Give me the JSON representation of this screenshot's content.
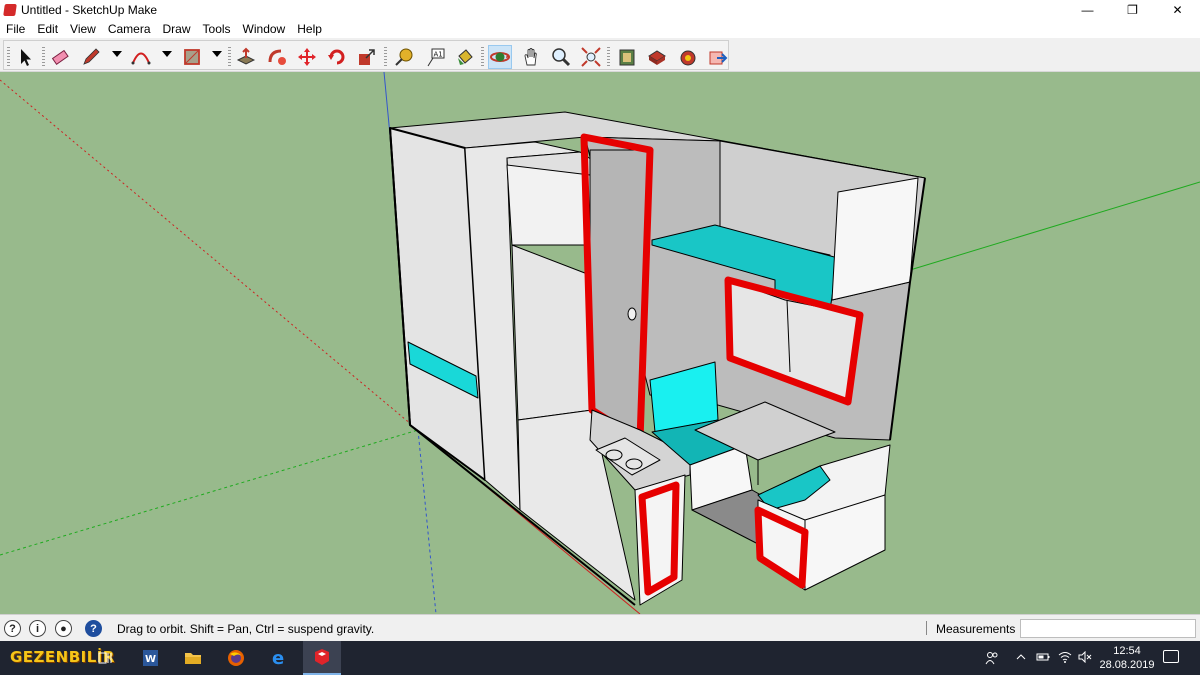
{
  "window": {
    "title": "Untitled - SketchUp Make",
    "minimize": "—",
    "restore": "❐",
    "close": "✕"
  },
  "menu": [
    "File",
    "Edit",
    "View",
    "Camera",
    "Draw",
    "Tools",
    "Window",
    "Help"
  ],
  "toolbar": {
    "tools": [
      "select-icon",
      "eraser-icon",
      "pencil-icon",
      "arc-icon",
      "rectangle-icon",
      "push-pull-icon",
      "follow-me-icon",
      "move-icon",
      "rotate-icon",
      "scale-icon",
      "tape-measure-icon",
      "text-icon",
      "paint-bucket-icon",
      "orbit-icon",
      "pan-icon",
      "zoom-icon",
      "zoom-extents-icon",
      "warehouse-icon",
      "extension-icon",
      "component-icon",
      "share-icon"
    ],
    "active_tool": "orbit-icon"
  },
  "status": {
    "hint": "Drag to orbit. Shift = Pan, Ctrl = suspend gravity.",
    "measurements_label": "Measurements",
    "measurements_value": ""
  },
  "taskbar": {
    "brand": "GEZENBILİR",
    "time": "12:54",
    "date": "28.08.2019"
  },
  "colors": {
    "sky": "#98ba8c",
    "accent_red": "#e60000",
    "accent_cyan": "#1fc9c9",
    "taskbar": "#1f2430"
  }
}
